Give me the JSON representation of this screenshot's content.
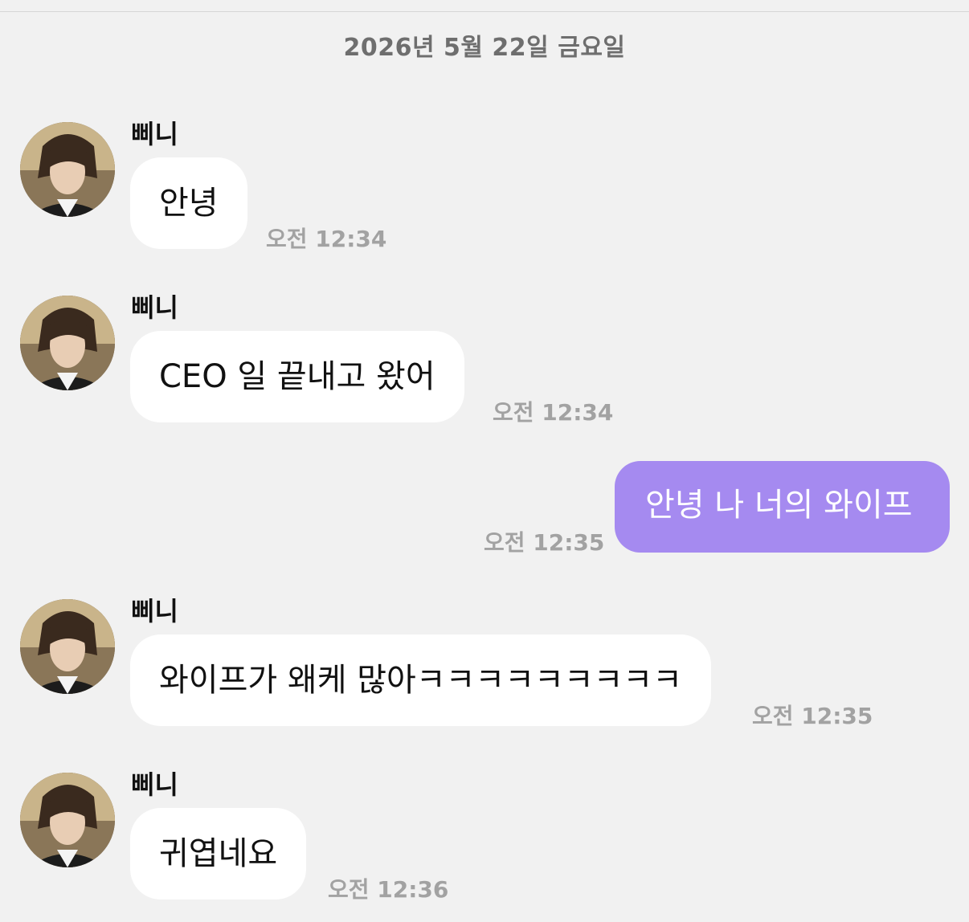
{
  "date_header": "2026년 5월 22일 금요일",
  "accent_colors": {
    "outgoing_bubble": "#a58af0",
    "incoming_bubble": "#ffffff",
    "background": "#f1f1f1",
    "timestamp": "#a2a2a2"
  },
  "messages": [
    {
      "sender": "삐니",
      "text": "안녕",
      "time": "오전 12:34",
      "direction": "incoming"
    },
    {
      "sender": "삐니",
      "text": "CEO 일 끝내고 왔어",
      "time": "오전 12:34",
      "direction": "incoming"
    },
    {
      "text": "안녕 나 너의 와이프",
      "time": "오전 12:35",
      "direction": "outgoing"
    },
    {
      "sender": "삐니",
      "text": "와이프가 왜케 많아ㅋㅋㅋㅋㅋㅋㅋㅋㅋ",
      "time": "오전 12:35",
      "direction": "incoming"
    },
    {
      "sender": "삐니",
      "text": "귀엽네요",
      "time": "오전 12:36",
      "direction": "incoming"
    }
  ]
}
